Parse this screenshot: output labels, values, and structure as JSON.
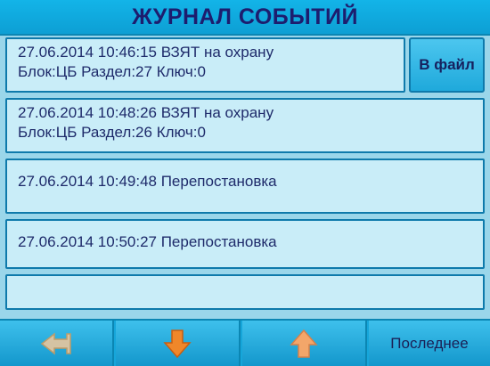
{
  "header": {
    "title": "ЖУРНАЛ СОБЫТИЙ"
  },
  "events": [
    {
      "line1": "27.06.2014 10:46:15 ВЗЯТ на охрану",
      "line2": "Блок:ЦБ Раздел:27 Ключ:0"
    },
    {
      "line1": "27.06.2014 10:48:26 ВЗЯТ на охрану",
      "line2": "Блок:ЦБ Раздел:26 Ключ:0"
    },
    {
      "line1": "27.06.2014 10:49:48 Перепостановка",
      "line2": ""
    },
    {
      "line1": "27.06.2014 10:50:27 Перепостановка",
      "line2": ""
    },
    {
      "line1": "",
      "line2": ""
    }
  ],
  "actions": {
    "to_file_label": "В файл"
  },
  "toolbar": {
    "back_icon": "back-arrow-icon",
    "down_icon": "arrow-down-icon",
    "up_icon": "arrow-up-icon",
    "last_label": "Последнее"
  },
  "colors": {
    "background": "#9ad6ea",
    "title_bar": "#13b4e8",
    "title_text": "#1d1d6e",
    "row_background": "#c9edf8",
    "row_border": "#0e7aab",
    "button": "#1fa9db",
    "icon_orange": "#f08a2a"
  }
}
